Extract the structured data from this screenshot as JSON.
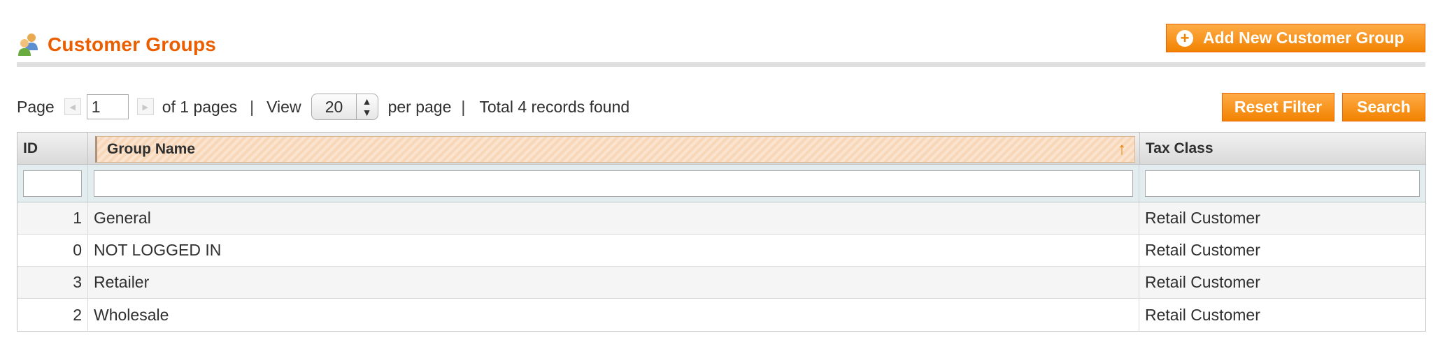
{
  "header": {
    "title": "Customer Groups",
    "add_button_label": "Add New Customer Group"
  },
  "pager": {
    "page_label": "Page",
    "page_value": "1",
    "of_pages": "of 1 pages",
    "separator": "|",
    "view_label": "View",
    "per_page_value": "20",
    "per_page_label": "per page",
    "total_records": "Total 4 records found"
  },
  "actions": {
    "reset_filter_label": "Reset Filter",
    "search_label": "Search"
  },
  "grid": {
    "columns": [
      {
        "label": "ID"
      },
      {
        "label": "Group Name"
      },
      {
        "label": "Tax Class"
      }
    ],
    "rows": [
      {
        "id": "1",
        "name": "General",
        "tax": "Retail Customer"
      },
      {
        "id": "0",
        "name": "NOT LOGGED IN",
        "tax": "Retail Customer"
      },
      {
        "id": "3",
        "name": "Retailer",
        "tax": "Retail Customer"
      },
      {
        "id": "2",
        "name": "Wholesale",
        "tax": "Retail Customer"
      }
    ]
  },
  "colors": {
    "accent": "#eb5e00",
    "button_orange": "#f18200"
  },
  "icons": {
    "title_icon": "users-icon",
    "add_icon": "plus-circle-icon",
    "prev_icon": "arrow-left-icon",
    "next_icon": "arrow-right-icon",
    "sort_icon": "sort-asc-arrow-icon"
  }
}
